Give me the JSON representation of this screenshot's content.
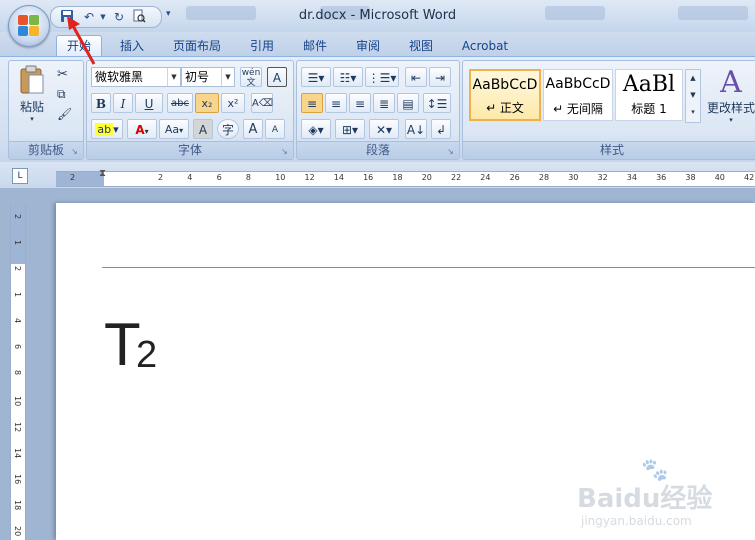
{
  "window": {
    "title": "dr.docx - Microsoft Word"
  },
  "quick_access": {
    "icons": [
      "save-icon",
      "undo-icon",
      "redo-icon",
      "print-preview-icon",
      "customize-icon"
    ]
  },
  "tabs": [
    "开始",
    "插入",
    "页面布局",
    "引用",
    "邮件",
    "审阅",
    "视图",
    "Acrobat"
  ],
  "ribbon": {
    "clipboard": {
      "label": "剪贴板",
      "paste": "粘贴"
    },
    "font": {
      "label": "字体",
      "font_name": "微软雅黑",
      "font_size": "初号",
      "bold": "B",
      "italic": "I",
      "underline": "U",
      "strike": "abc",
      "subscript": "x₂",
      "superscript": "x²",
      "color_a": "A",
      "case": "Aa",
      "char_border": "A",
      "enclose": "字",
      "grow": "A",
      "shrink": "A",
      "phonetic": "wén",
      "clear": "A"
    },
    "paragraph": {
      "label": "段落"
    },
    "styles": {
      "label": "样式",
      "items": [
        {
          "sample": "AaBbCcD",
          "name": "↵ 正文"
        },
        {
          "sample": "AaBbCcD",
          "name": "↵ 无间隔"
        },
        {
          "sample": "AaBl",
          "name": "标题 1"
        }
      ],
      "change_styles": "更改样式"
    }
  },
  "ruler": {
    "h_ticks": [
      "2",
      "2",
      "4",
      "6",
      "8",
      "10",
      "12",
      "14",
      "16",
      "18",
      "20",
      "22",
      "24",
      "26",
      "28",
      "30",
      "32",
      "34",
      "36",
      "38",
      "40",
      "42"
    ],
    "v_ticks": [
      "2",
      "1",
      "2",
      "1",
      "4",
      "6",
      "8",
      "10",
      "12",
      "14",
      "16",
      "18",
      "20"
    ],
    "tab_selector": "L"
  },
  "document": {
    "text_main": "T",
    "text_sub": "2"
  },
  "watermark": {
    "logo": "Baidu经验",
    "url": "jingyan.baidu.com"
  },
  "colors": {
    "accent_red": "#e0231b",
    "ribbon_blue": "#15428b"
  }
}
